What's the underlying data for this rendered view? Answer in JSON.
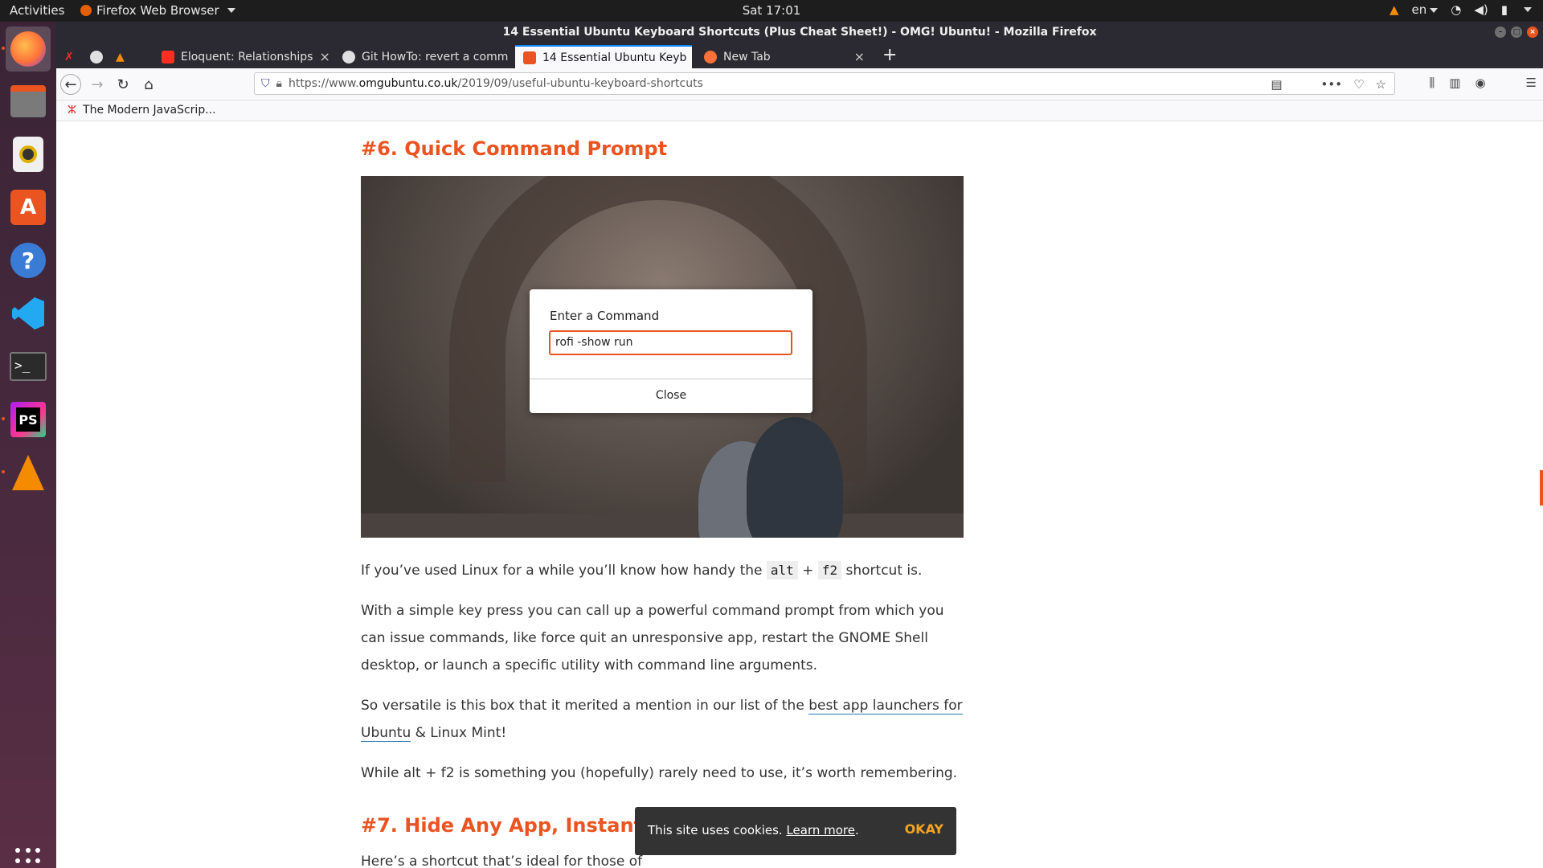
{
  "system": {
    "activities": "Activities",
    "app_menu": "Firefox Web Browser",
    "clock": "Sat 17:01",
    "language": "en"
  },
  "dock": {
    "items": [
      "Firefox",
      "Files",
      "Rhythmbox",
      "Ubuntu Software",
      "Help",
      "Visual Studio Code",
      "Terminal",
      "PhpStorm",
      "VLC"
    ]
  },
  "window": {
    "title": "14 Essential Ubuntu Keyboard Shortcuts (Plus Cheat Sheet!) - OMG! Ubuntu! - Mozilla Firefox"
  },
  "tabs": [
    {
      "label": "Eloquent: Relationships",
      "active": false
    },
    {
      "label": "Git HowTo: revert a comm",
      "active": false
    },
    {
      "label": "14 Essential Ubuntu Keyb",
      "active": true
    },
    {
      "label": "New Tab",
      "active": false
    }
  ],
  "url": {
    "prefix": "https://www.",
    "host": "omgubuntu.co.uk",
    "path": "/2019/09/useful-ubuntu-keyboard-shortcuts"
  },
  "bookmarks": {
    "item1": "The Modern JavaScrip..."
  },
  "article": {
    "heading6": "#6. Quick Command Prompt",
    "dialog": {
      "title": "Enter a Command",
      "input_value": "rofi -show run",
      "close": "Close"
    },
    "p1_a": "If you’ve used Linux for a while you’ll know how handy the ",
    "p1_code1": "alt",
    "p1_plus": " + ",
    "p1_code2": "f2",
    "p1_b": " shortcut is.",
    "p2": "With a simple key press you can call up a powerful command prompt from which you can issue commands, like force quit an unresponsive app, restart the GNOME Shell desktop, or launch a specific utility with command line arguments.",
    "p3_a": "So versatile is this box that it merited a mention in our list of the ",
    "p3_link": "best app launchers for Ubuntu",
    "p3_b": " & Linux Mint!",
    "p4": "While alt + f2 is something you (hopefully) rarely need to use, it’s worth remembering.",
    "heading7": "#7. Hide Any App, Instantly",
    "p5": "Here’s a shortcut that’s ideal for those of"
  },
  "cookie": {
    "text": "This site uses cookies. ",
    "learn_more": "Learn more",
    "period": ".",
    "ok": "OKAY"
  },
  "colors": {
    "ubuntu_orange": "#e95420",
    "cookie_ok": "#f3a521",
    "link_underline": "#2a7ab0"
  }
}
